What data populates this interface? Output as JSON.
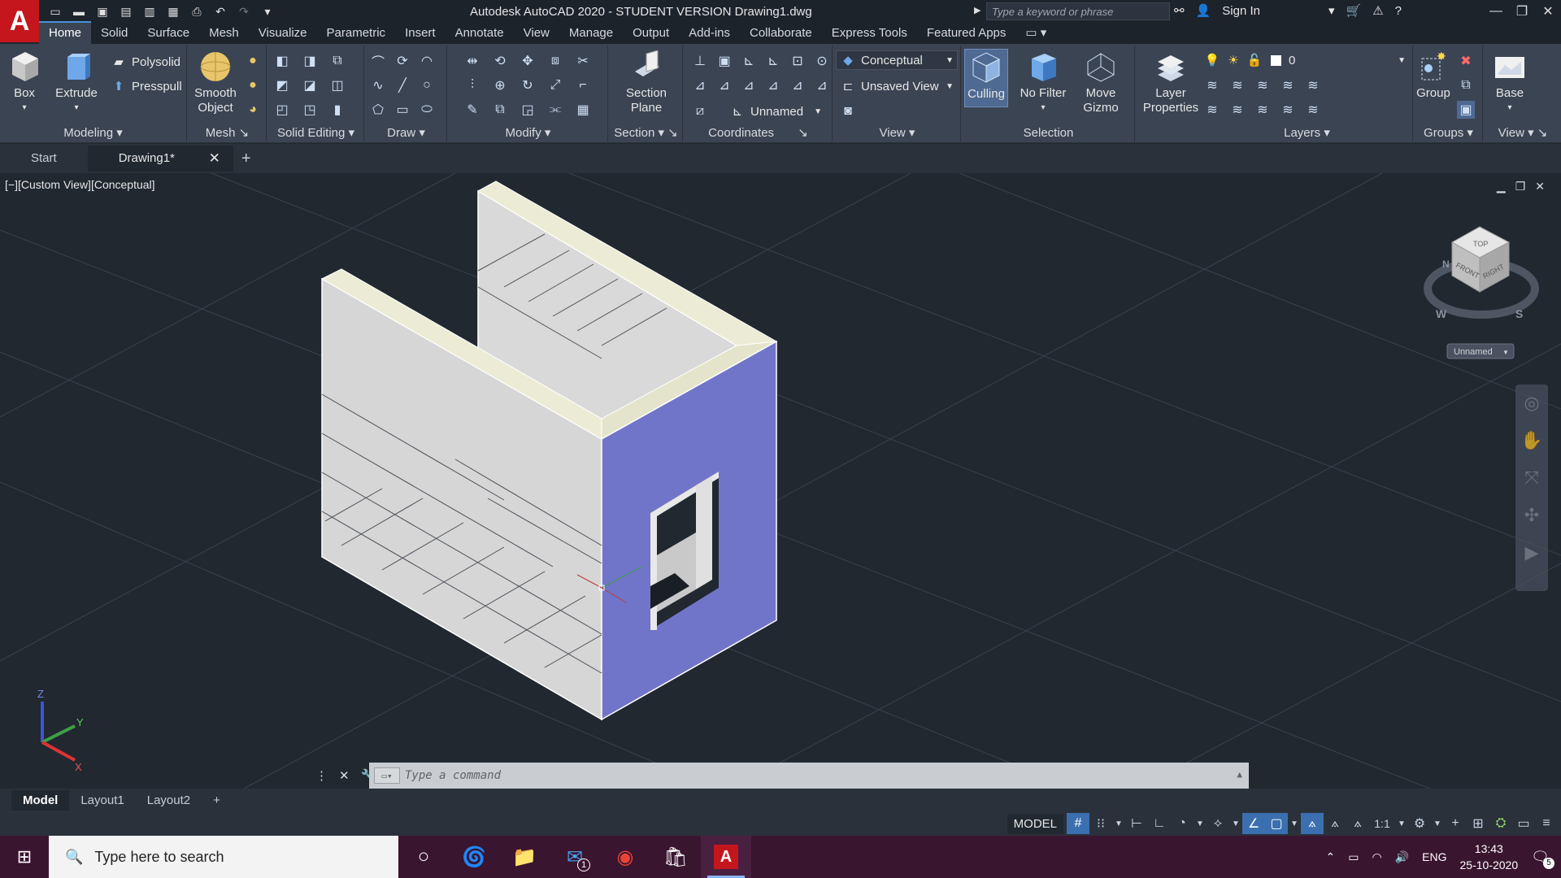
{
  "window": {
    "title": "Autodesk AutoCAD 2020 - STUDENT VERSION    Drawing1.dwg",
    "search_placeholder": "Type a keyword or phrase",
    "sign_in": "Sign In"
  },
  "app_logo": "A",
  "ribbon_tabs": [
    "Home",
    "Solid",
    "Surface",
    "Mesh",
    "Visualize",
    "Parametric",
    "Insert",
    "Annotate",
    "View",
    "Manage",
    "Output",
    "Add-ins",
    "Collaborate",
    "Express Tools",
    "Featured Apps"
  ],
  "ribbon": {
    "modeling": {
      "label": "Modeling",
      "box": "Box",
      "extrude": "Extrude",
      "polysolid": "Polysolid",
      "presspull": "Presspull"
    },
    "mesh": {
      "label": "Mesh",
      "smooth": "Smooth Object"
    },
    "solid_editing": {
      "label": "Solid Editing"
    },
    "draw": {
      "label": "Draw"
    },
    "modify": {
      "label": "Modify"
    },
    "section": {
      "label": "Section",
      "plane": "Section Plane"
    },
    "coordinates": {
      "label": "Coordinates",
      "ucs": "Unnamed"
    },
    "view": {
      "label": "View",
      "visual_style": "Conceptual",
      "named_view": "Unsaved View"
    },
    "selection": {
      "label": "Selection",
      "culling": "Culling",
      "no_filter": "No Filter",
      "move_gizmo": "Move Gizmo"
    },
    "layers": {
      "label": "Layers",
      "layer_properties": "Layer Properties",
      "current_layer": "0"
    },
    "groups": {
      "label": "Groups",
      "group": "Group"
    },
    "view2": {
      "label": "View",
      "base": "Base"
    }
  },
  "file_tabs": [
    {
      "label": "Start"
    },
    {
      "label": "Drawing1*"
    }
  ],
  "viewport": {
    "label": "[−][Custom View][Conceptual]",
    "viewcube": {
      "top": "TOP",
      "front": "FRONT",
      "right": "RIGHT",
      "w": "W",
      "n": "N",
      "s": "S",
      "ucs_name": "Unnamed"
    },
    "axes": {
      "x": "X",
      "y": "Y",
      "z": "Z"
    }
  },
  "command": {
    "placeholder": "Type  a  command"
  },
  "layout_tabs": [
    "Model",
    "Layout1",
    "Layout2"
  ],
  "status": {
    "model": "MODEL",
    "scale": "1:1"
  },
  "taskbar": {
    "search": "Type here to search",
    "lang": "ENG",
    "time": "13:43",
    "date": "25-10-2020",
    "notifications": "5",
    "mail_badge": "1"
  },
  "colors": {
    "accent": "#4a90d9",
    "face_blue": "#7175c9",
    "face_gray": "#d9d9d9",
    "face_top": "#ececd6",
    "viewport_bg": "#212830",
    "taskbar": "#3a1530"
  }
}
